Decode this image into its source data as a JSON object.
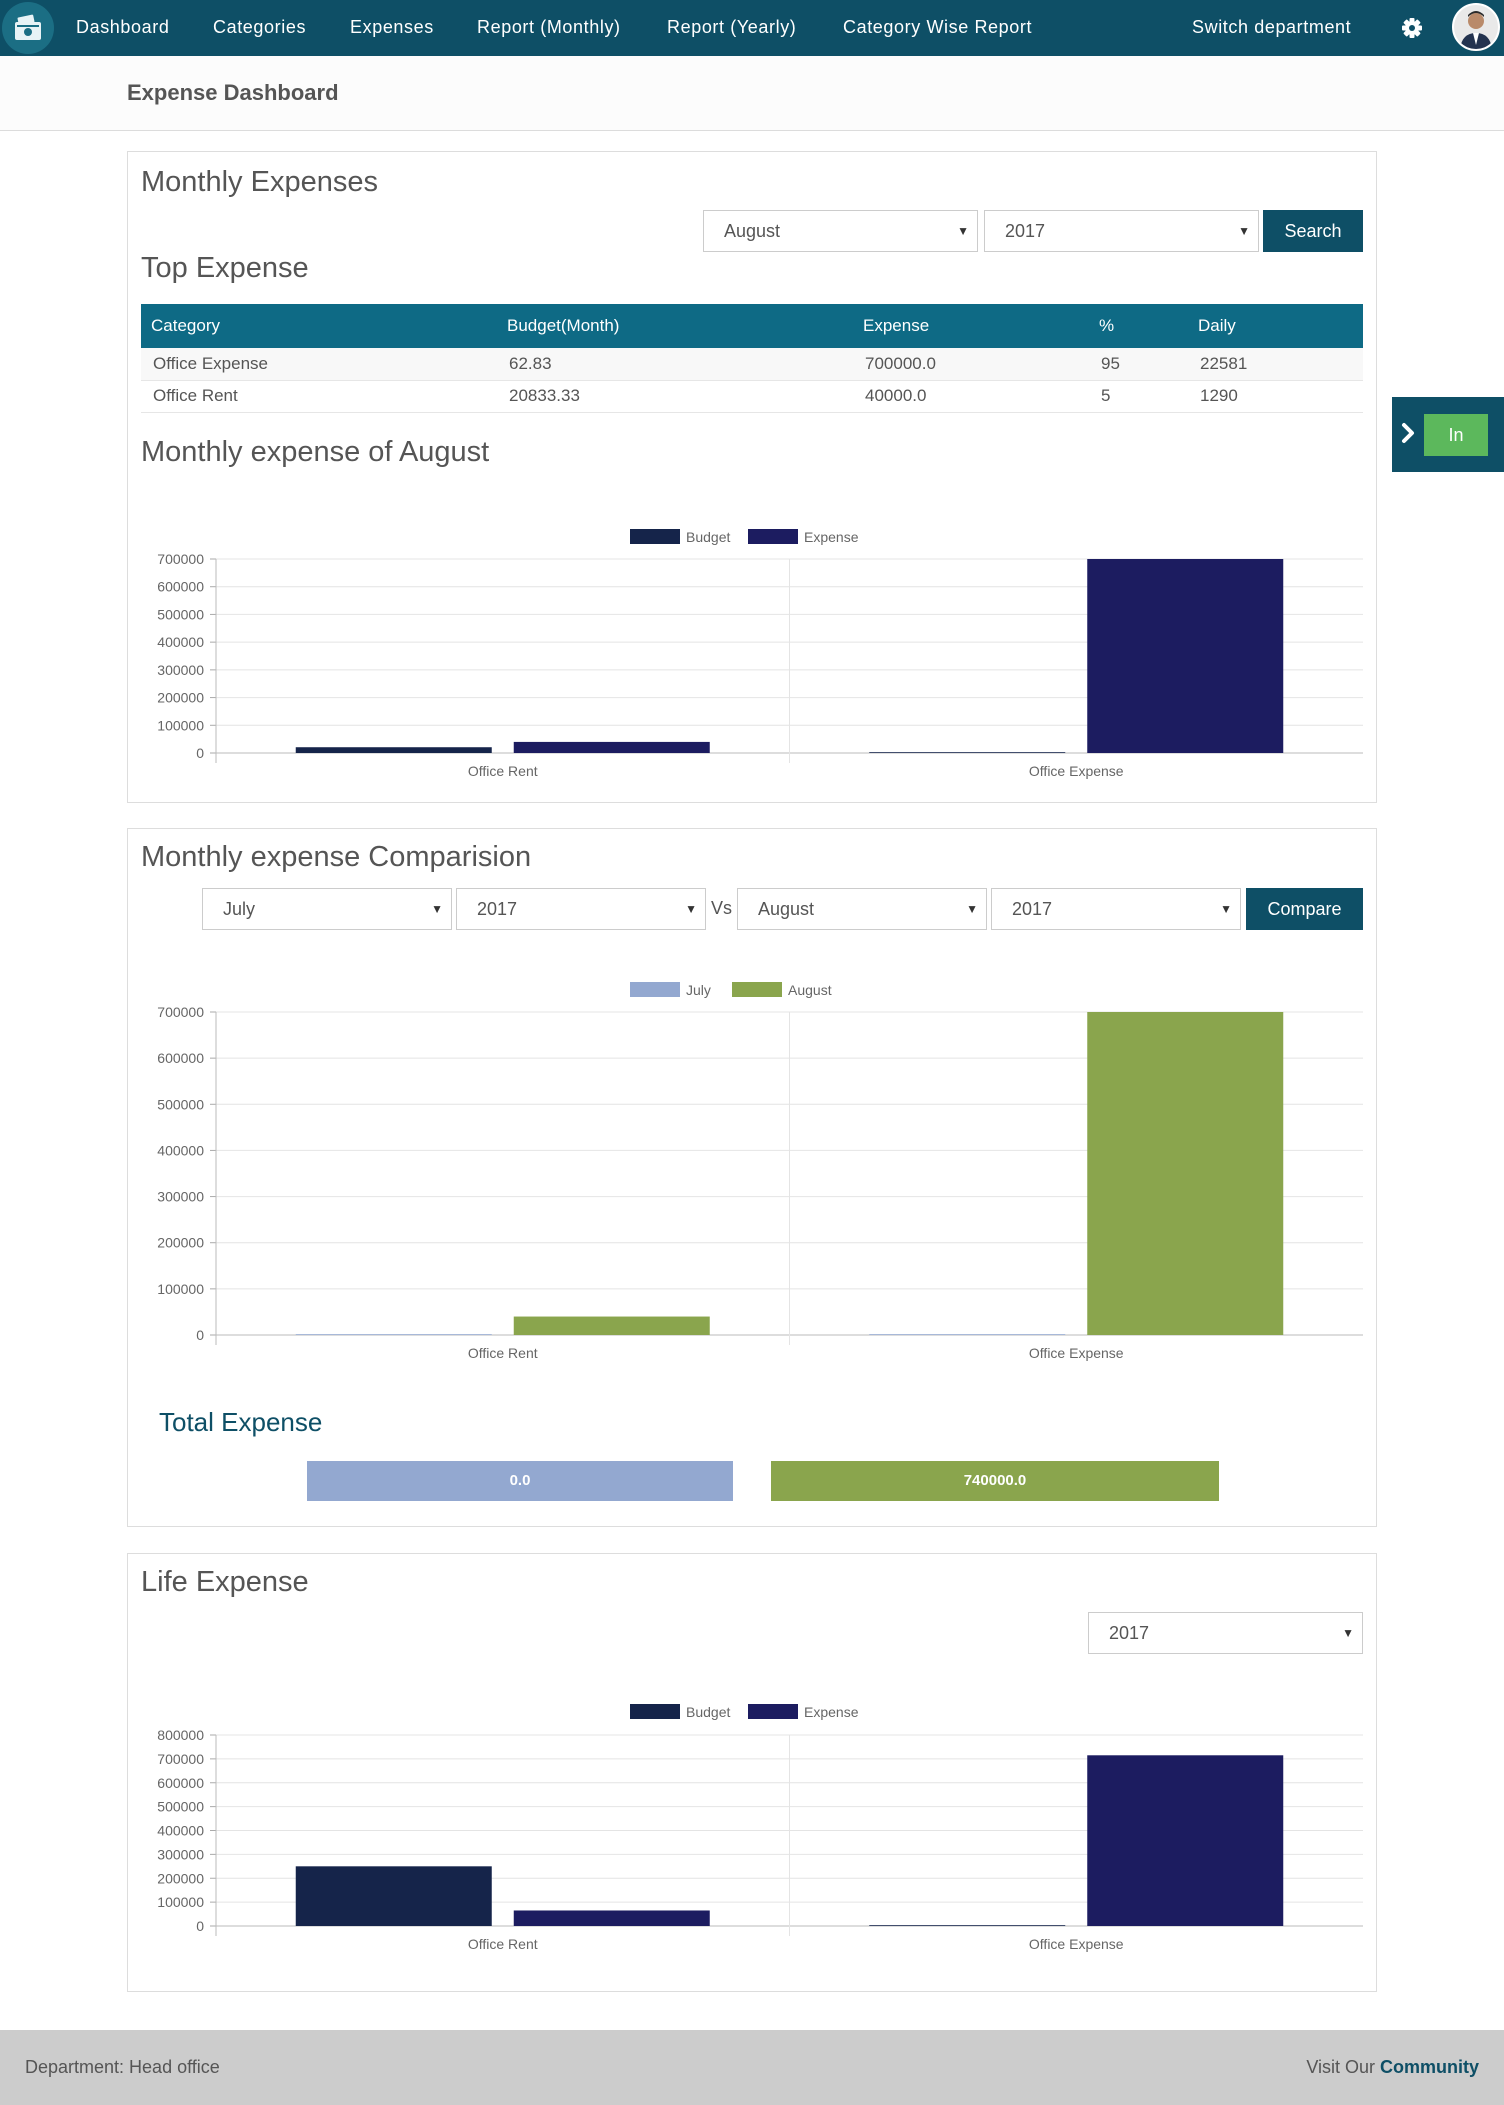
{
  "nav": {
    "items": [
      "Dashboard",
      "Categories",
      "Expenses",
      "Report (Monthly)",
      "Report (Yearly)",
      "Category Wise Report"
    ],
    "switch_department": "Switch department",
    "logo_icon": "wallet-icon",
    "settings_icon": "gear-icon"
  },
  "page_title": "Expense Dashboard",
  "monthly_expenses": {
    "title": "Monthly Expenses",
    "month_select": "August",
    "year_select": "2017",
    "search_label": "Search",
    "top_expense_title": "Top Expense",
    "table": {
      "headers": [
        "Category",
        "Budget(Month)",
        "Expense",
        "%",
        "Daily"
      ],
      "rows": [
        [
          "Office Expense",
          "62.83",
          "700000.0",
          "95",
          "22581"
        ],
        [
          "Office Rent",
          "20833.33",
          "40000.0",
          "5",
          "1290"
        ]
      ]
    },
    "chart_title": "Monthly expense of August"
  },
  "comparison": {
    "title": "Monthly expense Comparision",
    "month1": "July",
    "year1": "2017",
    "vs": "Vs",
    "month2": "August",
    "year2": "2017",
    "compare_label": "Compare",
    "total_title": "Total Expense",
    "total1": "0.0",
    "total2": "740000.0"
  },
  "life_expense": {
    "title": "Life Expense",
    "year_select": "2017"
  },
  "side_toggle": {
    "label": "In",
    "icon": "chevron-right-icon"
  },
  "footer": {
    "department": "Department: Head office",
    "visit_prefix": "Visit Our ",
    "community": "Community"
  },
  "colors": {
    "primary": "#0e4f66",
    "table_header": "#0e6a85",
    "budget": "#15244a",
    "expense": "#1c1c60",
    "july": "#93a8d0",
    "august": "#8aa54d",
    "green_button": "#5cb85c"
  },
  "chart_data": [
    {
      "type": "bar",
      "categories": [
        "Office Rent",
        "Office Expense"
      ],
      "series": [
        {
          "name": "Budget",
          "values": [
            20833.33,
            62.83
          ]
        },
        {
          "name": "Expense",
          "values": [
            40000,
            700000
          ]
        }
      ],
      "ylim": [
        0,
        700000
      ],
      "yticks": [
        0,
        100000,
        200000,
        300000,
        400000,
        500000,
        600000,
        700000
      ],
      "legend": "top"
    },
    {
      "type": "bar",
      "categories": [
        "Office Rent",
        "Office Expense"
      ],
      "series": [
        {
          "name": "July",
          "values": [
            0,
            0
          ]
        },
        {
          "name": "August",
          "values": [
            40000,
            700000
          ]
        }
      ],
      "ylim": [
        0,
        700000
      ],
      "yticks": [
        0,
        100000,
        200000,
        300000,
        400000,
        500000,
        600000,
        700000
      ],
      "legend": "top"
    },
    {
      "type": "bar",
      "categories": [
        "Office Rent",
        "Office Expense"
      ],
      "series": [
        {
          "name": "Budget",
          "values": [
            250000,
            750.0
          ]
        },
        {
          "name": "Expense",
          "values": [
            65000,
            715000
          ]
        }
      ],
      "ylim": [
        0,
        800000
      ],
      "yticks": [
        0,
        100000,
        200000,
        300000,
        400000,
        500000,
        600000,
        700000,
        800000
      ],
      "legend": "top"
    }
  ]
}
